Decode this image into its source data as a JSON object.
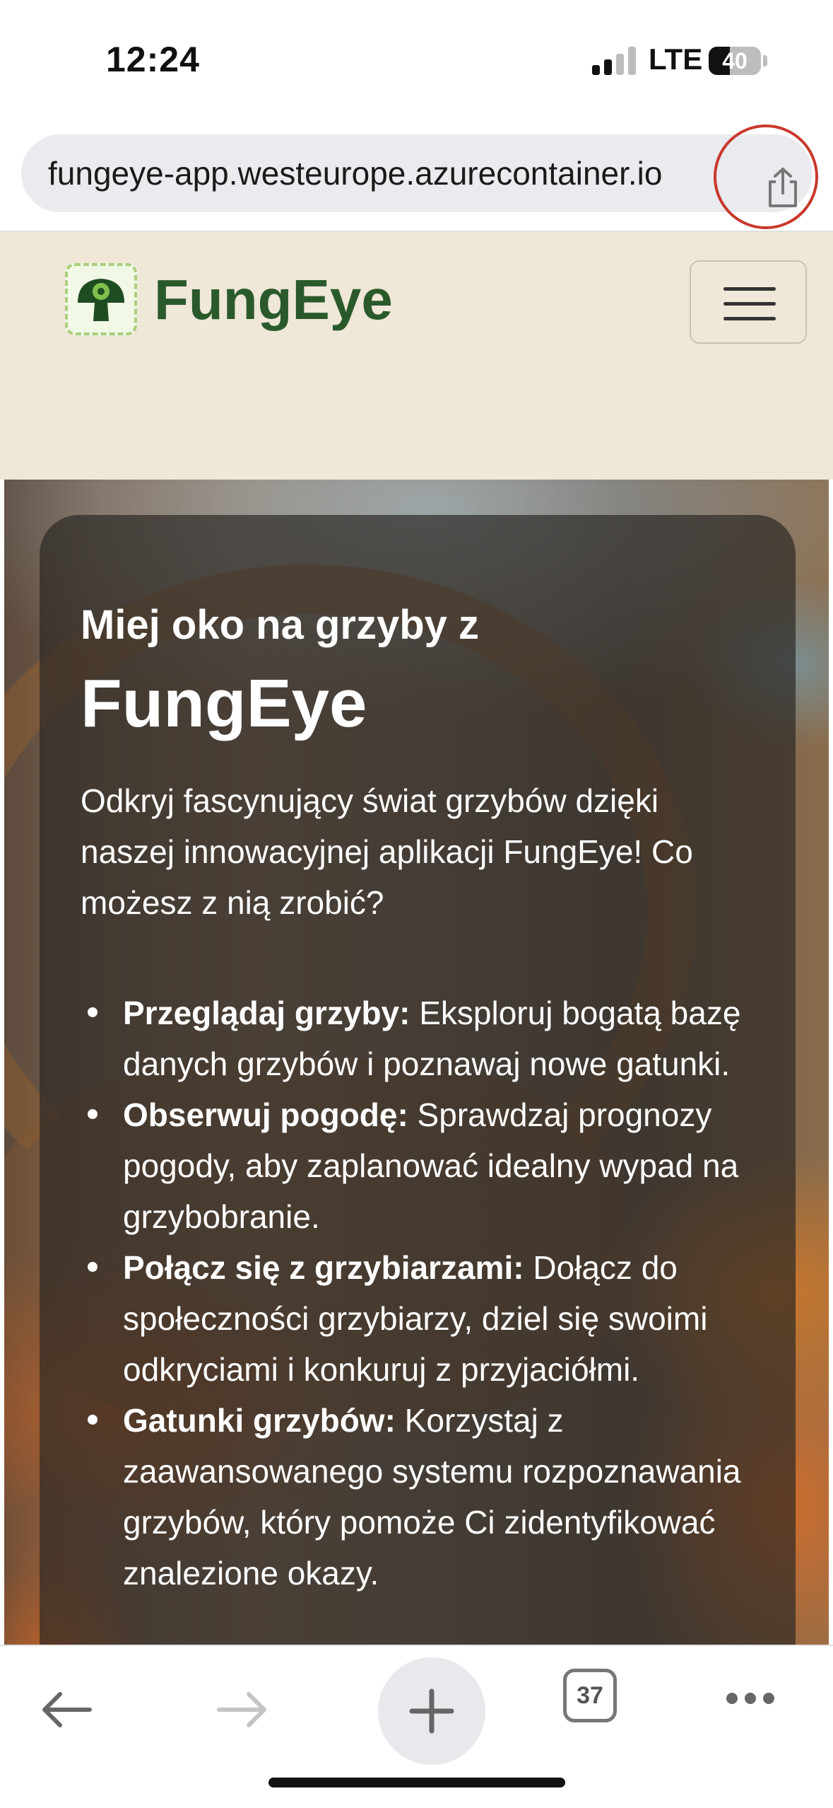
{
  "status_bar": {
    "time": "12:24",
    "network": "LTE",
    "battery_percent": "40",
    "signal_bars_active": 2,
    "signal_bars_total": 4
  },
  "browser": {
    "url": "fungeye-app.westeurope.azurecontainer.io",
    "share_icon": "share-icon",
    "annotation_color": "#c8382b",
    "tab_count": "37"
  },
  "site": {
    "brand": "FungEye",
    "header_bg": "#efe7d8",
    "brand_color": "#2a5a2c"
  },
  "hero": {
    "kicker": "Miej oko na grzyby z",
    "title": "FungEye",
    "intro": "Odkryj fascynujący świat grzybów dzięki naszej innowacyjnej aplikacji FungEye! Co możesz z nią zrobić?",
    "features": [
      {
        "title": "Przeglądaj grzyby:",
        "text": " Eksploruj bogatą bazę danych grzybów i poznawaj nowe gatunki."
      },
      {
        "title": "Obserwuj pogodę:",
        "text": " Sprawdzaj prognozy pogody, aby zaplanować idealny wypad na grzybobranie."
      },
      {
        "title": "Połącz się z grzybiarzami:",
        "text": " Dołącz do społeczności grzybiarzy, dziel się swoimi odkryciami i konkuruj z przyjaciółmi."
      },
      {
        "title": "Gatunki grzybów:",
        "text": " Korzystaj z zaawansowanego systemu rozpoznawania grzybów, który pomoże Ci zidentyfikować znalezione okazy."
      }
    ]
  },
  "toolbar": {
    "back_icon": "back-arrow-icon",
    "forward_icon": "forward-arrow-icon",
    "new_tab_icon": "plus-icon",
    "tabs_icon": "tabs-icon",
    "more_icon": "more-dots-icon"
  }
}
